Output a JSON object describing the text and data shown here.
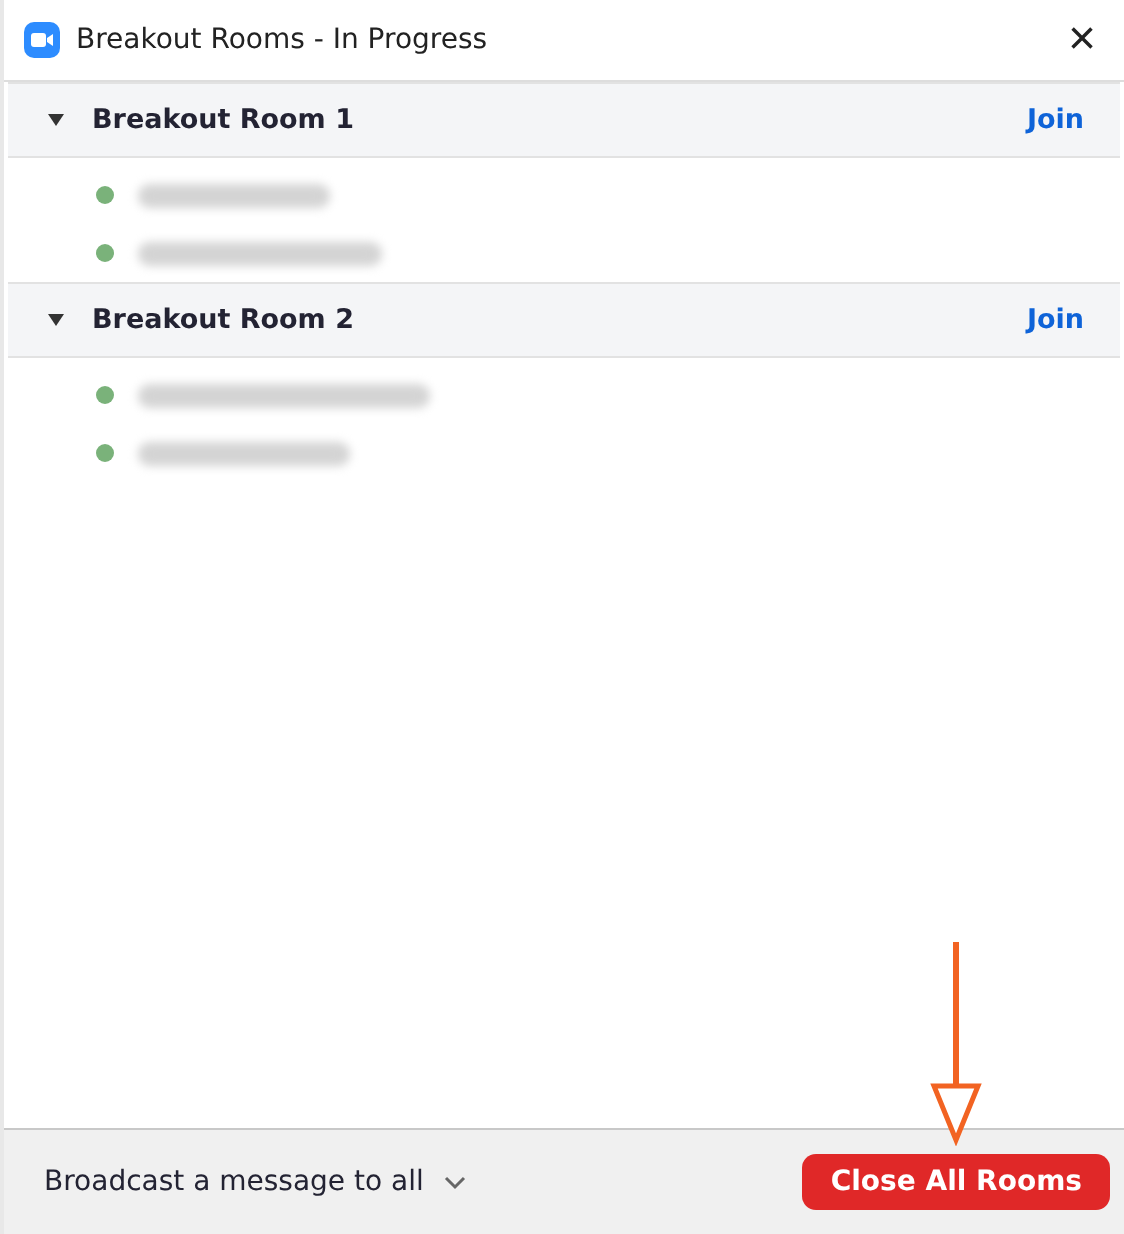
{
  "window": {
    "title": "Breakout Rooms - In Progress",
    "close": "×"
  },
  "rooms": [
    {
      "name": "Breakout Room 1",
      "expanded": true,
      "action": "Join",
      "participants": [
        {
          "kind": "blurred"
        },
        {
          "kind": "blurred"
        }
      ]
    },
    {
      "name": "Breakout Room 2",
      "expanded": true,
      "action": "Join",
      "participants": [
        {
          "kind": "blurred"
        },
        {
          "kind": "blurred"
        }
      ]
    }
  ],
  "footer": {
    "broadcast": "Broadcast a message to all",
    "close_all": "Close All Rooms"
  }
}
